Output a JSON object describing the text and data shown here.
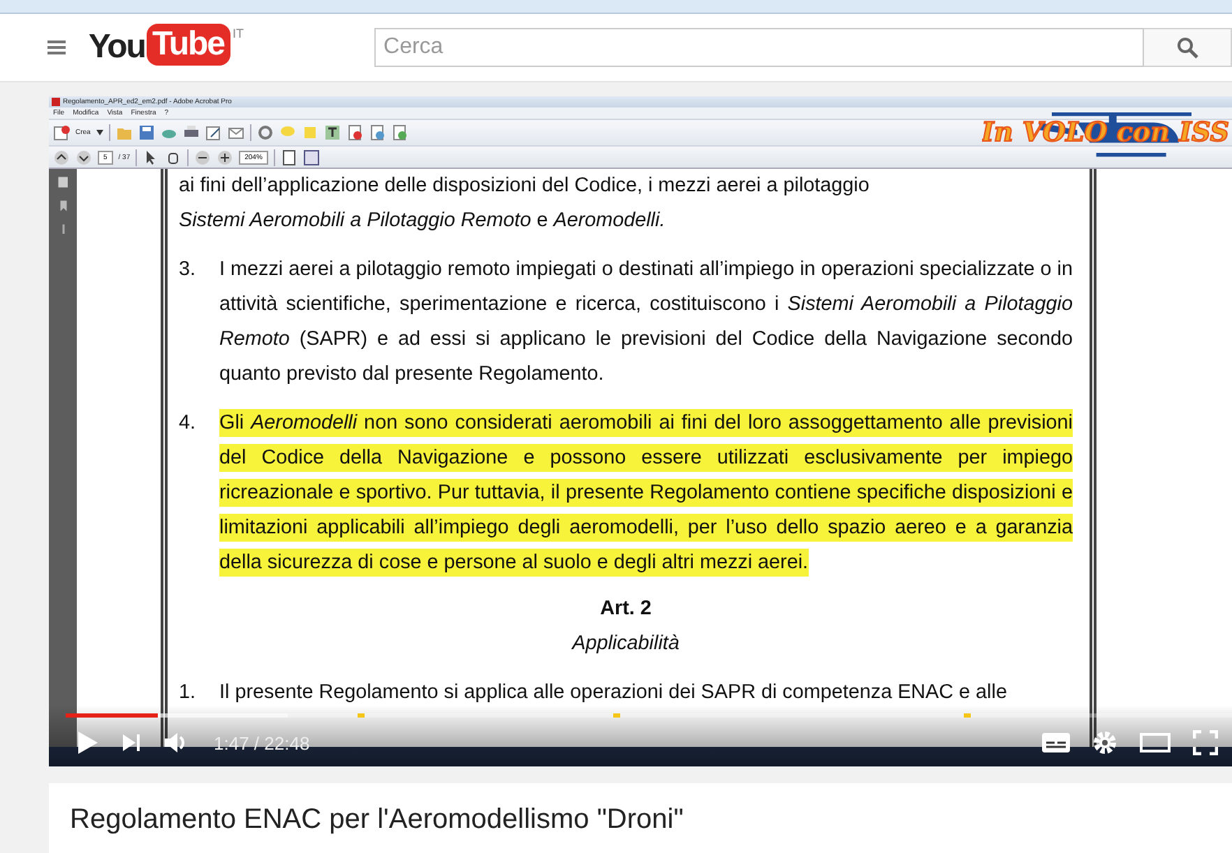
{
  "header": {
    "logo": "YouTube",
    "region": "IT",
    "search": {
      "placeholder": "Cerca"
    }
  },
  "video": {
    "acrobat": {
      "title": "Regolamento_APR_ed2_em2.pdf - Adobe Acrobat Pro",
      "menu": [
        "File",
        "Modifica",
        "Vista",
        "Finestra",
        "?"
      ],
      "create_button": "Crea",
      "page": "5",
      "page_count": "/ 37",
      "zoom": "204%"
    },
    "overlay_logo": "In VOLO con ISS",
    "document": {
      "lines": [
        {
          "kind": "plain",
          "text": "ai fini dell’applicazione delle disposizioni del Codice, i mezzi aerei a pilotaggio"
        },
        {
          "kind": "plain",
          "text": "*Sistemi Aeromobili a Pilotaggio Remoto* e *Aeromodelli.*"
        },
        {
          "kind": "item",
          "number": "3.",
          "highlighted": false,
          "text": "I mezzi aerei a pilotaggio remoto impiegati o destinati all’impiego in operazioni specializzate o in attività scientifiche, sperimentazione e ricerca, costituiscono i *Sistemi Aeromobili a Pilotaggio Remoto* (SAPR) e ad essi si applicano le previsioni del Codice della Navigazione secondo quanto previsto dal presente Regolamento."
        },
        {
          "kind": "item",
          "number": "4.",
          "highlighted": true,
          "text": "Gli *Aeromodelli* non sono considerati aeromobili ai fini del loro assoggettamento alle previsioni del Codice della Navigazione e possono essere utilizzati esclusivamente per impiego ricreazionale e sportivo. Pur tuttavia, il presente Regolamento contiene specifiche disposizioni e limitazioni applicabili all’impiego degli aeromodelli, per l’uso dello spazio aereo e a garanzia della sicurezza di cose e persone al suolo e degli altri mezzi aerei."
        },
        {
          "kind": "heading",
          "text": "Art. 2"
        },
        {
          "kind": "subheading",
          "text": "Applicabilità"
        },
        {
          "kind": "item",
          "number": "1.",
          "highlighted": false,
          "text": "Il presente Regolamento si applica alle operazioni dei SAPR di competenza ENAC e alle"
        }
      ]
    },
    "player": {
      "time": "1:47 / 22:48",
      "progress": {
        "level": 0.079
      },
      "buffer": {
        "level": 0.19
      }
    }
  },
  "title": "Regolamento ENAC per l'Aeromodellismo \"Droni\""
}
